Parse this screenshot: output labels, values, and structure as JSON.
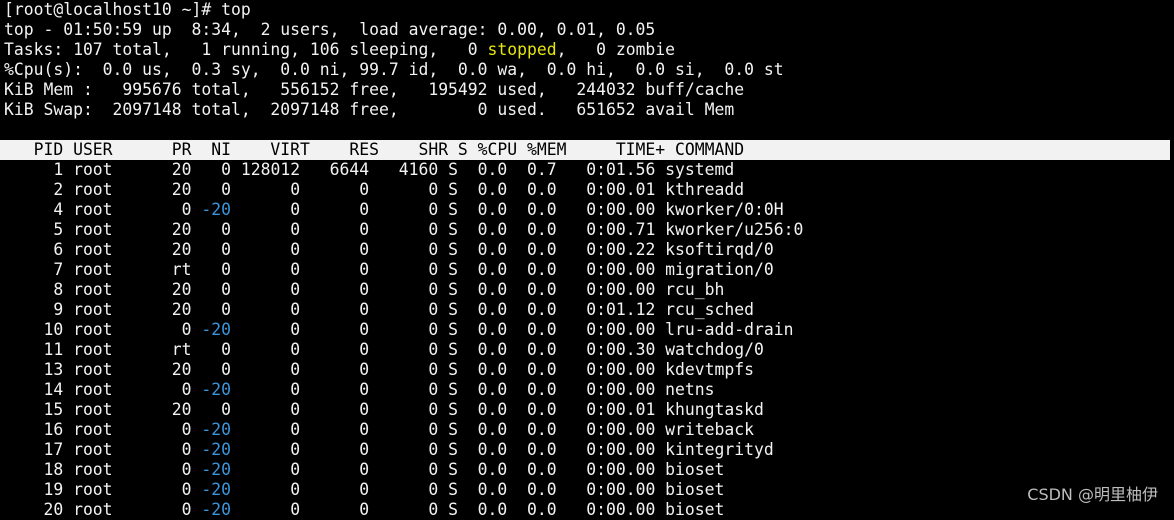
{
  "prompt": "[root@localhost10 ~]# top",
  "summary": {
    "uptime_line": "top - 01:50:59 up  8:34,  2 users,  load average: 0.00, 0.01, 0.05",
    "tasks_pre": "Tasks: 107 total,   1 running, 106 sleeping,   0 ",
    "tasks_stopped": "stopped",
    "tasks_post": ",   0 zombie",
    "cpu_line": "%Cpu(s):  0.0 us,  0.3 sy,  0.0 ni, 99.7 id,  0.0 wa,  0.0 hi,  0.0 si,  0.0 st",
    "mem_line": "KiB Mem :   995676 total,   556152 free,   195492 used,   244032 buff/cache",
    "swap_line": "KiB Swap:  2097148 total,  2097148 free,        0 used.   651652 avail Mem"
  },
  "table_header": "   PID USER      PR  NI    VIRT    RES    SHR S %CPU %MEM     TIME+ COMMAND",
  "rows": [
    {
      "a": "     1 root      20   ",
      "ni": "0",
      "b": " 128012   6644   4160 S  0.0  0.7   0:01.56 systemd"
    },
    {
      "a": "     2 root      20   ",
      "ni": "0",
      "b": "      0      0      0 S  0.0  0.0   0:00.01 kthreadd"
    },
    {
      "a": "     4 root       0 ",
      "ni": "-20",
      "b": "      0      0      0 S  0.0  0.0   0:00.00 kworker/0:0H"
    },
    {
      "a": "     5 root      20   ",
      "ni": "0",
      "b": "      0      0      0 S  0.0  0.0   0:00.71 kworker/u256:0"
    },
    {
      "a": "     6 root      20   ",
      "ni": "0",
      "b": "      0      0      0 S  0.0  0.0   0:00.22 ksoftirqd/0"
    },
    {
      "a": "     7 root      rt   ",
      "ni": "0",
      "b": "      0      0      0 S  0.0  0.0   0:00.00 migration/0"
    },
    {
      "a": "     8 root      20   ",
      "ni": "0",
      "b": "      0      0      0 S  0.0  0.0   0:00.00 rcu_bh"
    },
    {
      "a": "     9 root      20   ",
      "ni": "0",
      "b": "      0      0      0 S  0.0  0.0   0:01.12 rcu_sched"
    },
    {
      "a": "    10 root       0 ",
      "ni": "-20",
      "b": "      0      0      0 S  0.0  0.0   0:00.00 lru-add-drain"
    },
    {
      "a": "    11 root      rt   ",
      "ni": "0",
      "b": "      0      0      0 S  0.0  0.0   0:00.30 watchdog/0"
    },
    {
      "a": "    13 root      20   ",
      "ni": "0",
      "b": "      0      0      0 S  0.0  0.0   0:00.00 kdevtmpfs"
    },
    {
      "a": "    14 root       0 ",
      "ni": "-20",
      "b": "      0      0      0 S  0.0  0.0   0:00.00 netns"
    },
    {
      "a": "    15 root      20   ",
      "ni": "0",
      "b": "      0      0      0 S  0.0  0.0   0:00.01 khungtaskd"
    },
    {
      "a": "    16 root       0 ",
      "ni": "-20",
      "b": "      0      0      0 S  0.0  0.0   0:00.00 writeback"
    },
    {
      "a": "    17 root       0 ",
      "ni": "-20",
      "b": "      0      0      0 S  0.0  0.0   0:00.00 kintegrityd"
    },
    {
      "a": "    18 root       0 ",
      "ni": "-20",
      "b": "      0      0      0 S  0.0  0.0   0:00.00 bioset"
    },
    {
      "a": "    19 root       0 ",
      "ni": "-20",
      "b": "      0      0      0 S  0.0  0.0   0:00.00 bioset"
    },
    {
      "a": "    20 root       0 ",
      "ni": "-20",
      "b": "      0      0      0 S  0.0  0.0   0:00.00 bioset"
    }
  ],
  "watermark": "CSDN @明里柚伊",
  "colors": {
    "background": "#000000",
    "foreground": "#f2f2f2",
    "header_bar": "#f2f2f2",
    "stopped_highlight": "#e5e510",
    "negative_nice": "#3a96dd"
  }
}
